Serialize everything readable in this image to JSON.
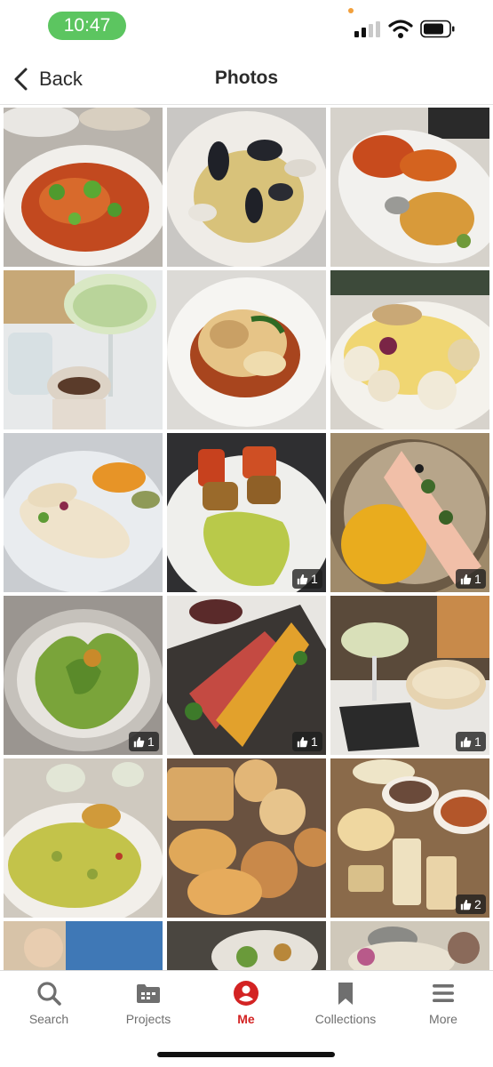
{
  "status_bar": {
    "time": "10:47",
    "time_pill_color": "#5cc560",
    "icons": [
      "cellular-signal-icon",
      "wifi-icon",
      "battery-icon"
    ]
  },
  "nav": {
    "back_label": "Back",
    "title": "Photos"
  },
  "photos": [
    {
      "subject": "pasta-with-microgreens",
      "likes": ""
    },
    {
      "subject": "mussels-clams-linguine",
      "likes": ""
    },
    {
      "subject": "lobster-pasta-platter",
      "likes": ""
    },
    {
      "subject": "cucumber-cocktail-and-dessert",
      "likes": ""
    },
    {
      "subject": "fish-fillet-with-sauce",
      "likes": ""
    },
    {
      "subject": "roasted-cauliflower-plate",
      "likes": ""
    },
    {
      "subject": "crepe-wraps-with-sauce",
      "likes": ""
    },
    {
      "subject": "croquettes-with-green-sauce",
      "likes": "1"
    },
    {
      "subject": "salmon-crudo-yellow-sauce",
      "likes": "1"
    },
    {
      "subject": "green-dumplings",
      "likes": "1"
    },
    {
      "subject": "seared-tuna-board",
      "likes": "1"
    },
    {
      "subject": "cocktails-espresso-martini",
      "likes": "1"
    },
    {
      "subject": "pesto-cavatappi",
      "likes": ""
    },
    {
      "subject": "bread-rolls-basket",
      "likes": ""
    },
    {
      "subject": "appetizer-platter",
      "likes": "2"
    },
    {
      "subject": "partial-photo-row",
      "likes": ""
    },
    {
      "subject": "partial-photo-row",
      "likes": ""
    },
    {
      "subject": "partial-photo-row",
      "likes": ""
    }
  ],
  "like_icon": "thumbs-up-icon",
  "tabs": [
    {
      "label": "Search",
      "icon": "search-icon"
    },
    {
      "label": "Projects",
      "icon": "projects-icon"
    },
    {
      "label": "Me",
      "icon": "me-icon"
    },
    {
      "label": "Collections",
      "icon": "bookmark-icon"
    },
    {
      "label": "More",
      "icon": "menu-icon"
    }
  ],
  "colors": {
    "accent": "#d32323",
    "tab_inactive": "#6f6f6f"
  }
}
